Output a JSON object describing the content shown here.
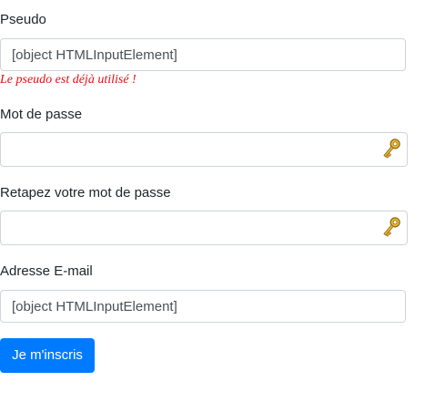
{
  "form": {
    "pseudo": {
      "label": "Pseudo",
      "value": "[object HTMLInputElement]",
      "error": "Le pseudo est déjà utilisé !"
    },
    "password": {
      "label": "Mot de passe",
      "value": "",
      "icon": "key-icon"
    },
    "password_confirm": {
      "label": "Retapez votre mot de passe",
      "value": "",
      "icon": "key-icon"
    },
    "email": {
      "label": "Adresse E-mail",
      "value": "[object HTMLInputElement]"
    },
    "submit_label": "Je m'inscris"
  },
  "colors": {
    "primary": "#007bff",
    "error": "#e01010",
    "border": "#ced4da",
    "key_gold": "#d4a017"
  }
}
